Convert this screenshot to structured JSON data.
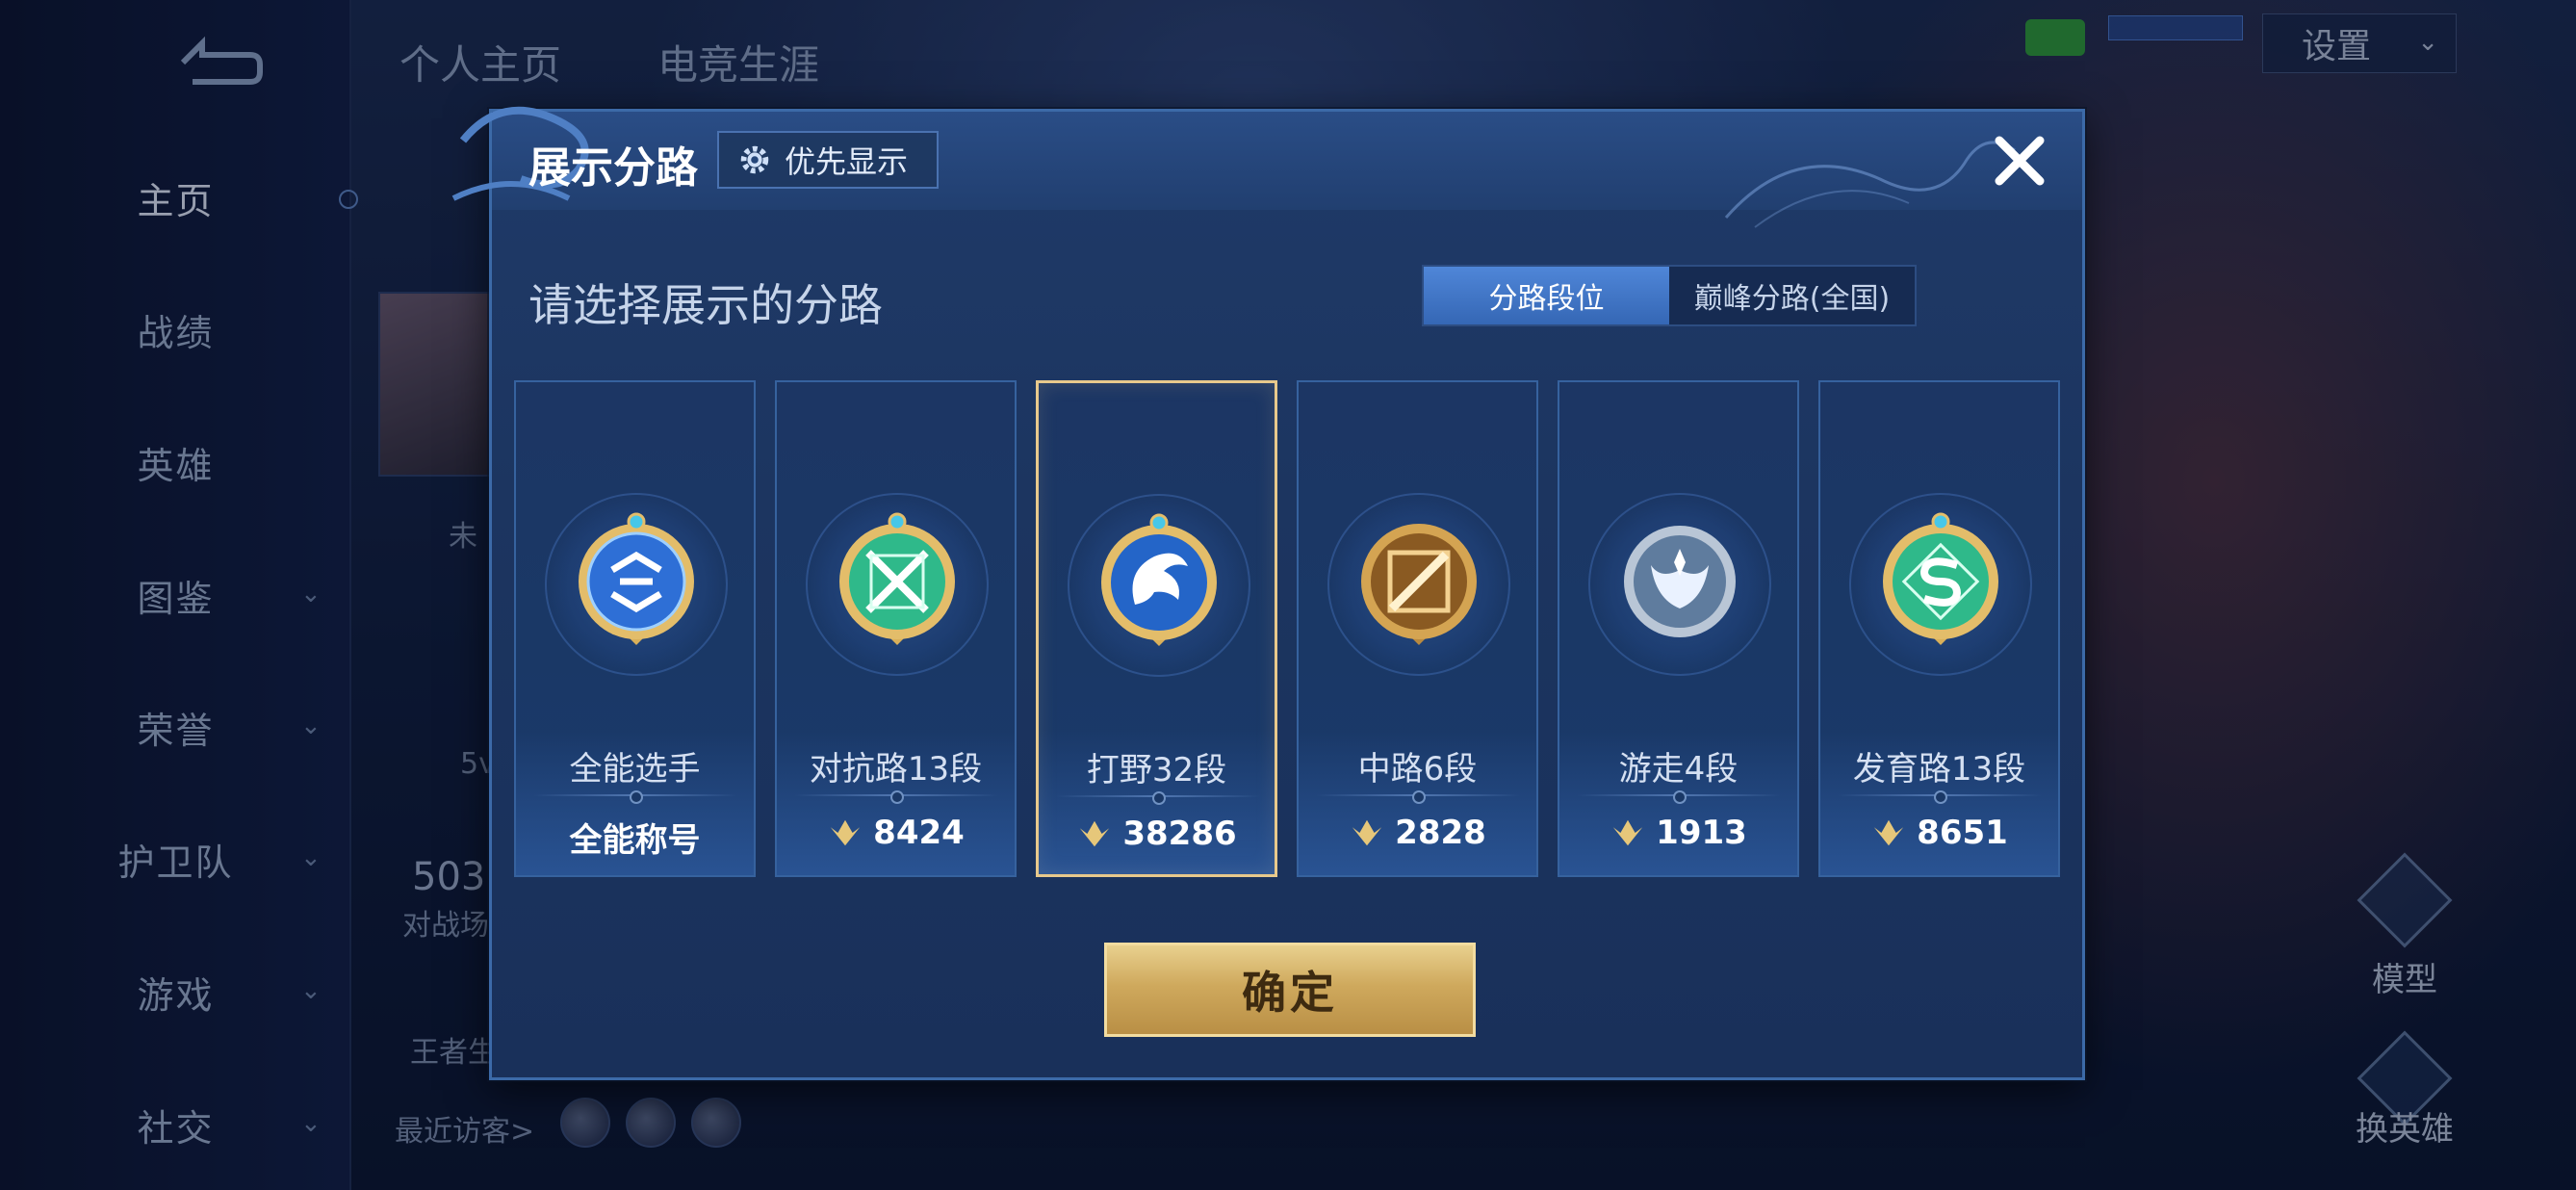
{
  "background": {
    "sidebar": {
      "items": [
        {
          "label": "主页",
          "has_chevron": false
        },
        {
          "label": "战绩",
          "has_chevron": false
        },
        {
          "label": "英雄",
          "has_chevron": false
        },
        {
          "label": "图鉴",
          "has_chevron": true
        },
        {
          "label": "荣誉",
          "has_chevron": true
        },
        {
          "label": "护卫队",
          "has_chevron": true
        },
        {
          "label": "游戏",
          "has_chevron": true
        },
        {
          "label": "社交",
          "has_chevron": true
        }
      ],
      "active": "主页"
    },
    "top_tabs": [
      "个人主页",
      "电竞生涯"
    ],
    "settings_label": "设置",
    "fragments": {
      "frag_1": "未",
      "frag_2": "5v",
      "frag_3": "503",
      "frag_4": "对战场",
      "frag_5": "王者生",
      "recent_visitors": "最近访客>"
    },
    "right_controls": {
      "model": "模型",
      "switch_hero": "换英雄"
    }
  },
  "modal": {
    "title": "展示分路",
    "priority_button": "优先显示",
    "subtitle": "请选择展示的分路",
    "segments": [
      {
        "label": "分路段位",
        "active": true
      },
      {
        "label": "巅峰分路(全国)",
        "active": false
      }
    ],
    "cards": [
      {
        "lane": "全能选手",
        "bottom": "全能称号",
        "score": null,
        "emblem": "all-round-emblem",
        "color": "#2e6fd6",
        "selected": false
      },
      {
        "lane": "对抗路13段",
        "bottom": null,
        "score": "8424",
        "emblem": "clash-lane-emblem",
        "color": "#2fb98a",
        "selected": false
      },
      {
        "lane": "打野32段",
        "bottom": null,
        "score": "38286",
        "emblem": "jungle-emblem",
        "color": "#2465c8",
        "selected": true
      },
      {
        "lane": "中路6段",
        "bottom": null,
        "score": "2828",
        "emblem": "mid-lane-emblem",
        "color": "#c98a2e",
        "selected": false
      },
      {
        "lane": "游走4段",
        "bottom": null,
        "score": "1913",
        "emblem": "roam-emblem",
        "color": "#7f9ab8",
        "selected": false
      },
      {
        "lane": "发育路13段",
        "bottom": null,
        "score": "8651",
        "emblem": "farm-lane-emblem",
        "color": "#2fb98a",
        "selected": false
      }
    ],
    "confirm_button": "确定"
  },
  "colors": {
    "accent_blue": "#3c6aa8",
    "gold": "#cfa95d",
    "selected_border": "#e8c98c"
  }
}
